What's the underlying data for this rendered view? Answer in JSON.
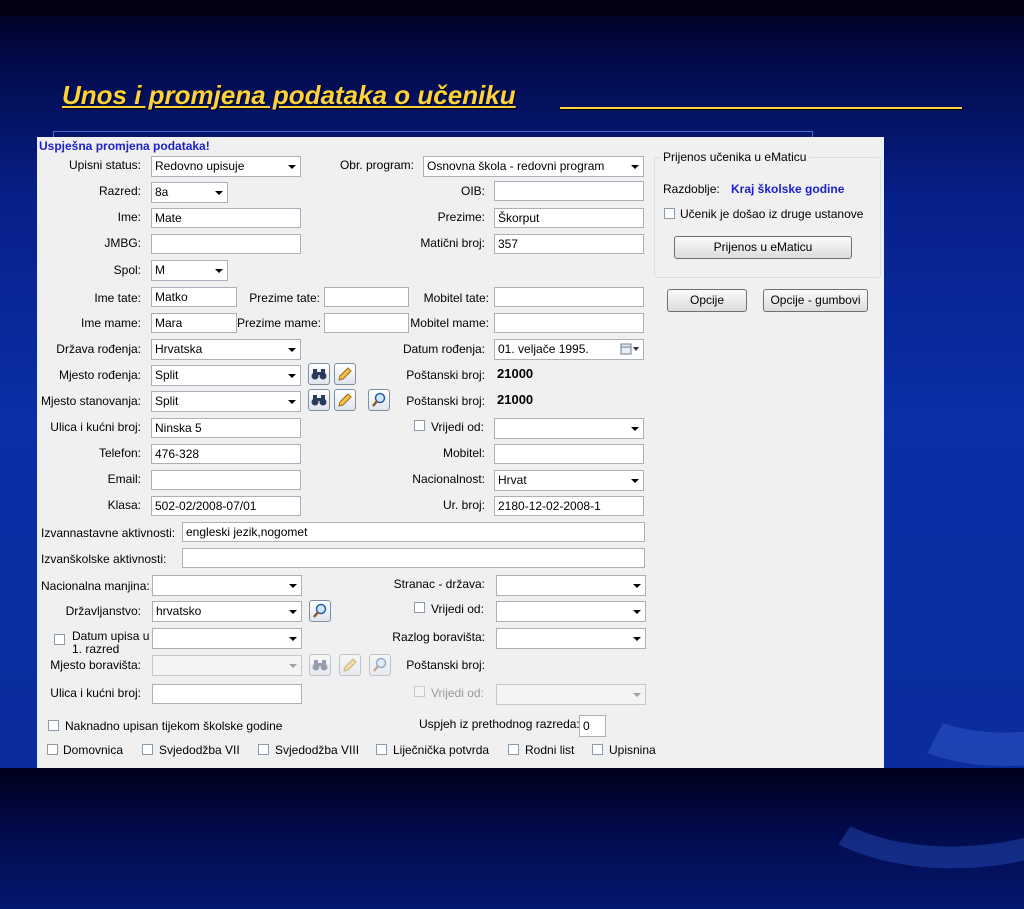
{
  "slide": {
    "title": "Unos i promjena podataka o učeniku"
  },
  "form": {
    "status_message": "Uspješna promjena podataka!",
    "upisni_status": {
      "label": "Upisni status:",
      "value": "Redovno upisuje"
    },
    "obr_program": {
      "label": "Obr. program:",
      "value": "Osnovna škola - redovni program"
    },
    "razred": {
      "label": "Razred:",
      "value": "8a"
    },
    "oib": {
      "label": "OIB:",
      "value": ""
    },
    "ime": {
      "label": "Ime:",
      "value": "Mate"
    },
    "prezime": {
      "label": "Prezime:",
      "value": "Škorput"
    },
    "jmbg": {
      "label": "JMBG:",
      "value": ""
    },
    "maticni_broj": {
      "label": "Matični broj:",
      "value": "357"
    },
    "spol": {
      "label": "Spol:",
      "value": "M"
    },
    "ime_tate": {
      "label": "Ime tate:",
      "value": "Matko"
    },
    "prezime_tate": {
      "label": "Prezime tate:",
      "value": ""
    },
    "mobitel_tate": {
      "label": "Mobitel tate:",
      "value": ""
    },
    "ime_mame": {
      "label": "Ime mame:",
      "value": "Mara"
    },
    "prezime_mame": {
      "label": "Prezime mame:",
      "value": ""
    },
    "mobitel_mame": {
      "label": "Mobitel mame:",
      "value": ""
    },
    "drzava_rodjenja": {
      "label": "Država rođenja:",
      "value": "Hrvatska"
    },
    "datum_rodjenja": {
      "label": "Datum rođenja:",
      "value": "01.  veljače  1995."
    },
    "mjesto_rodjenja": {
      "label": "Mjesto rođenja:",
      "value": "Split"
    },
    "postanski_broj_1": {
      "label": "Poštanski broj:",
      "value": "21000"
    },
    "mjesto_stanovanja": {
      "label": "Mjesto stanovanja:",
      "value": "Split"
    },
    "postanski_broj_2": {
      "label": "Poštanski broj:",
      "value": "21000"
    },
    "ulica": {
      "label": "Ulica i kućni broj:",
      "value": "Ninska 5"
    },
    "vrijedi_od_1": {
      "label": "Vrijedi od:",
      "value": ""
    },
    "telefon": {
      "label": "Telefon:",
      "value": "476-328"
    },
    "mobitel": {
      "label": "Mobitel:",
      "value": ""
    },
    "email": {
      "label": "Email:",
      "value": ""
    },
    "nacionalnost": {
      "label": "Nacionalnost:",
      "value": "Hrvat"
    },
    "klasa": {
      "label": "Klasa:",
      "value": "502-02/2008-07/01"
    },
    "ur_broj": {
      "label": "Ur. broj:",
      "value": "2180-12-02-2008-1"
    },
    "izvannastavne": {
      "label": "Izvannastavne aktivnosti:",
      "value": "engleski jezik,nogomet"
    },
    "izvanskolske": {
      "label": "Izvanškolske aktivnosti:",
      "value": ""
    },
    "nacionalna_manjina": {
      "label": "Nacionalna manjina:",
      "value": ""
    },
    "stranac_drzava": {
      "label": "Stranac - država:",
      "value": ""
    },
    "drzavljanstvo": {
      "label": "Državljanstvo:",
      "value": "hrvatsko"
    },
    "vrijedi_od_2": {
      "label": "Vrijedi od:",
      "value": ""
    },
    "datum_upisa": {
      "label_line1": "Datum upisa u",
      "label_line2": "1. razred",
      "value": ""
    },
    "razlog_boravista": {
      "label": "Razlog boravišta:",
      "value": ""
    },
    "mjesto_boravista": {
      "label": "Mjesto boravišta:",
      "value": ""
    },
    "postanski_broj_3": {
      "label": "Poštanski broj:",
      "value": ""
    },
    "ulica_boravista": {
      "label": "Ulica i kućni broj:",
      "value": ""
    },
    "vrijedi_od_3": {
      "label": "Vrijedi od:",
      "value": ""
    },
    "naknadno_upisan": {
      "label": "Naknadno upisan tijekom školske godine"
    },
    "uspjeh": {
      "label": "Uspjeh iz prethodnog razreda:",
      "value": "0"
    },
    "documents": [
      "Domovnica",
      "Svjedodžba VII",
      "Svjedodžba VIII",
      "Liječnička potvrda",
      "Rodni list",
      "Upisnina"
    ]
  },
  "ematica": {
    "group_title": "Prijenos učenika u eMaticu",
    "razdoblje_label": "Razdoblje:",
    "razdoblje_value": "Kraj školske godine",
    "checkbox_label": "Učenik je došao iz druge ustanove",
    "transfer_button": "Prijenos u eMaticu"
  },
  "buttons": {
    "opcije": "Opcije",
    "opcije_gumbovi": "Opcije - gumbovi"
  },
  "icons": [
    "binoculars-icon",
    "pencil-icon",
    "magnifier-icon",
    "calendar-icon"
  ]
}
